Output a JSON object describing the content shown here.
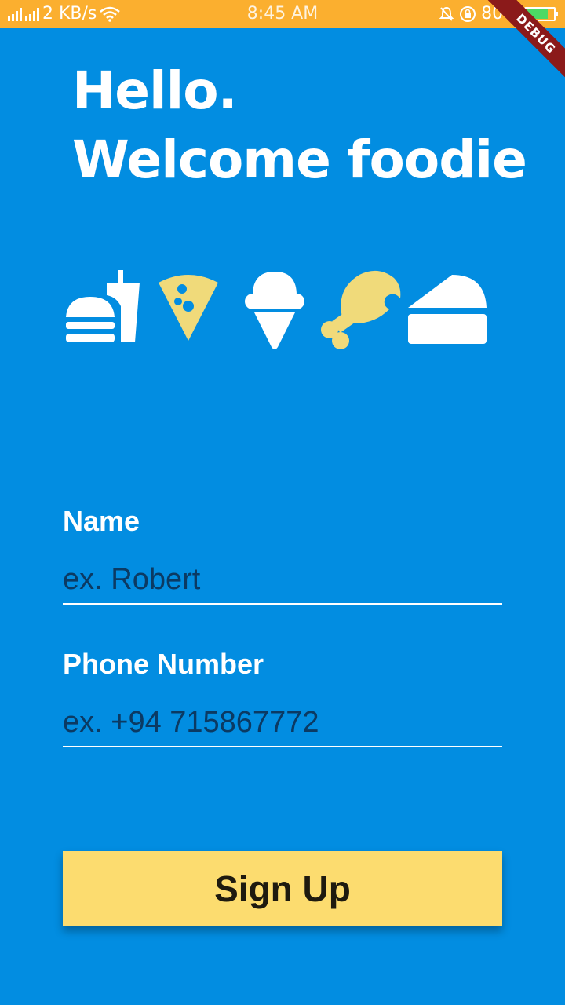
{
  "status_bar": {
    "network_speed": "2 KB/s",
    "time": "8:45 AM",
    "battery": "80%",
    "battery_level": 0.8
  },
  "debug_banner": "DEBUG",
  "greeting": {
    "line1": "Hello.",
    "line2": "Welcome foodie"
  },
  "colors": {
    "background": "#028de1",
    "status_bar": "#fbaf2f",
    "accent_yellow": "#f0da7a",
    "button": "#fcdc6f"
  },
  "food_icons": [
    "burger-drink-icon",
    "pizza-slice-icon",
    "ice-cream-icon",
    "chicken-leg-icon",
    "cake-slice-icon"
  ],
  "form": {
    "name": {
      "label": "Name",
      "placeholder": "ex. Robert",
      "value": ""
    },
    "phone": {
      "label": "Phone Number",
      "placeholder": "ex. +94 715867772",
      "value": ""
    },
    "submit_label": "Sign Up"
  }
}
